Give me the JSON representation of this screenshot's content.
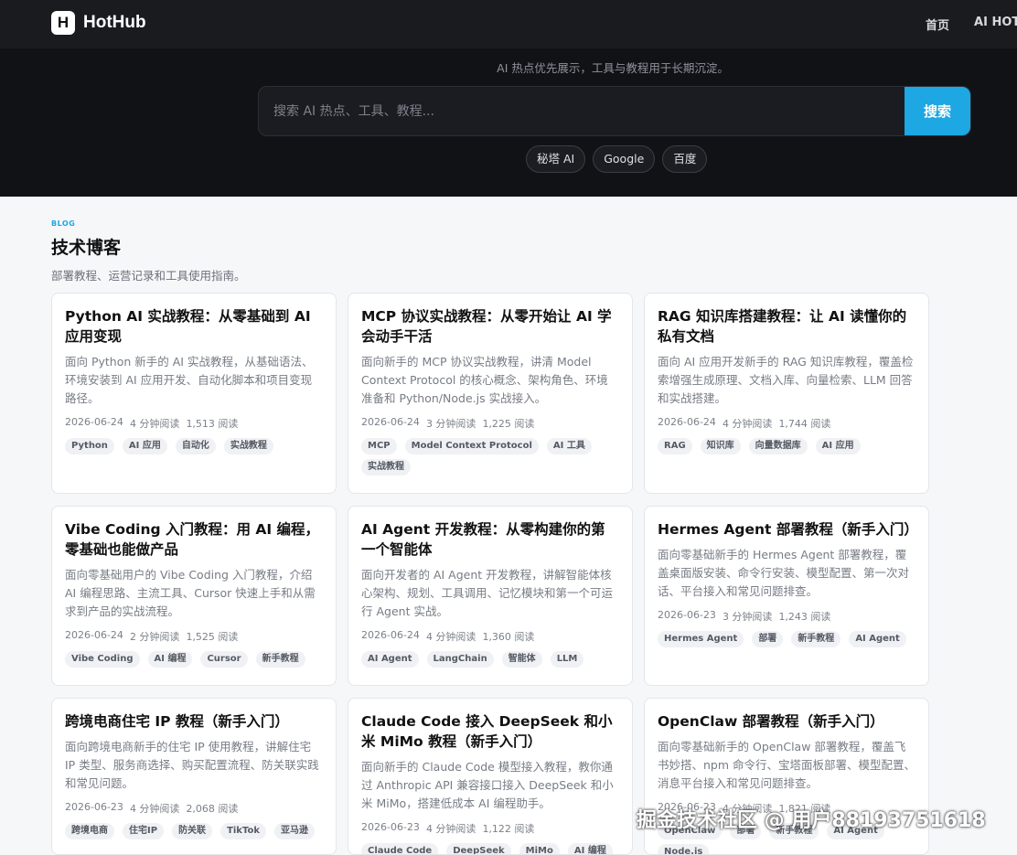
{
  "header": {
    "logo_letter": "H",
    "brand": "HotHub",
    "nav": [
      "首页",
      "AI HOT"
    ]
  },
  "hero": {
    "subtitle": "AI 热点优先展示，工具与教程用于长期沉淀。",
    "search_placeholder": "搜索 AI 热点、工具、教程...",
    "search_button": "搜索",
    "engines": [
      "秘塔 AI",
      "Google",
      "百度"
    ]
  },
  "blog": {
    "tag": "BLOG",
    "title": "技术博客",
    "desc": "部署教程、运营记录和工具使用指南。",
    "cards": [
      {
        "title": "Python AI 实战教程：从零基础到 AI 应用变现",
        "excerpt": "面向 Python 新手的 AI 实战教程，从基础语法、环境安装到 AI 应用开发、自动化脚本和项目变现路径。",
        "date": "2026-06-24",
        "read_time": "4 分钟阅读",
        "views": "1,513 阅读",
        "tags": [
          "Python",
          "AI 应用",
          "自动化",
          "实战教程"
        ]
      },
      {
        "title": "MCP 协议实战教程：从零开始让 AI 学会动手干活",
        "excerpt": "面向新手的 MCP 协议实战教程，讲清 Model Context Protocol 的核心概念、架构角色、环境准备和 Python/Node.js 实战接入。",
        "date": "2026-06-24",
        "read_time": "3 分钟阅读",
        "views": "1,225 阅读",
        "tags": [
          "MCP",
          "Model Context Protocol",
          "AI 工具",
          "实战教程"
        ]
      },
      {
        "title": "RAG 知识库搭建教程：让 AI 读懂你的私有文档",
        "excerpt": "面向 AI 应用开发新手的 RAG 知识库教程，覆盖检索增强生成原理、文档入库、向量检索、LLM 回答和实战搭建。",
        "date": "2026-06-24",
        "read_time": "4 分钟阅读",
        "views": "1,744 阅读",
        "tags": [
          "RAG",
          "知识库",
          "向量数据库",
          "AI 应用"
        ]
      },
      {
        "title": "Vibe Coding 入门教程：用 AI 编程，零基础也能做产品",
        "excerpt": "面向零基础用户的 Vibe Coding 入门教程，介绍 AI 编程思路、主流工具、Cursor 快速上手和从需求到产品的实战流程。",
        "date": "2026-06-24",
        "read_time": "2 分钟阅读",
        "views": "1,525 阅读",
        "tags": [
          "Vibe Coding",
          "AI 编程",
          "Cursor",
          "新手教程"
        ]
      },
      {
        "title": "AI Agent 开发教程：从零构建你的第一个智能体",
        "excerpt": "面向开发者的 AI Agent 开发教程，讲解智能体核心架构、规划、工具调用、记忆模块和第一个可运行 Agent 实战。",
        "date": "2026-06-24",
        "read_time": "4 分钟阅读",
        "views": "1,360 阅读",
        "tags": [
          "AI Agent",
          "LangChain",
          "智能体",
          "LLM"
        ]
      },
      {
        "title": "Hermes Agent 部署教程（新手入门）",
        "excerpt": "面向零基础新手的 Hermes Agent 部署教程，覆盖桌面版安装、命令行安装、模型配置、第一次对话、平台接入和常见问题排查。",
        "date": "2026-06-23",
        "read_time": "3 分钟阅读",
        "views": "1,243 阅读",
        "tags": [
          "Hermes Agent",
          "部署",
          "新手教程",
          "AI Agent"
        ]
      },
      {
        "title": "跨境电商住宅 IP 教程（新手入门）",
        "excerpt": "面向跨境电商新手的住宅 IP 使用教程，讲解住宅 IP 类型、服务商选择、购买配置流程、防关联实践和常见问题。",
        "date": "2026-06-23",
        "read_time": "4 分钟阅读",
        "views": "2,068 阅读",
        "tags": [
          "跨境电商",
          "住宅IP",
          "防关联",
          "TikTok",
          "亚马逊"
        ]
      },
      {
        "title": "Claude Code 接入 DeepSeek 和小米 MiMo 教程（新手入门）",
        "excerpt": "面向新手的 Claude Code 模型接入教程，教你通过 Anthropic API 兼容接口接入 DeepSeek 和小米 MiMo，搭建低成本 AI 编程助手。",
        "date": "2026-06-23",
        "read_time": "4 分钟阅读",
        "views": "1,122 阅读",
        "tags": [
          "Claude Code",
          "DeepSeek",
          "MiMo",
          "AI 编程"
        ]
      },
      {
        "title": "OpenClaw 部署教程（新手入门）",
        "excerpt": "面向零基础新手的 OpenClaw 部署教程，覆盖飞书妙搭、npm 命令行、宝塔面板部署、模型配置、消息平台接入和常见问题排查。",
        "date": "2026-06-23",
        "read_time": "4 分钟阅读",
        "views": "1,821 阅读",
        "tags": [
          "OpenClaw",
          "部署",
          "新手教程",
          "AI Agent",
          "Node.js"
        ]
      }
    ]
  },
  "watermark": "掘金技术社区 @ 用户88193751618"
}
